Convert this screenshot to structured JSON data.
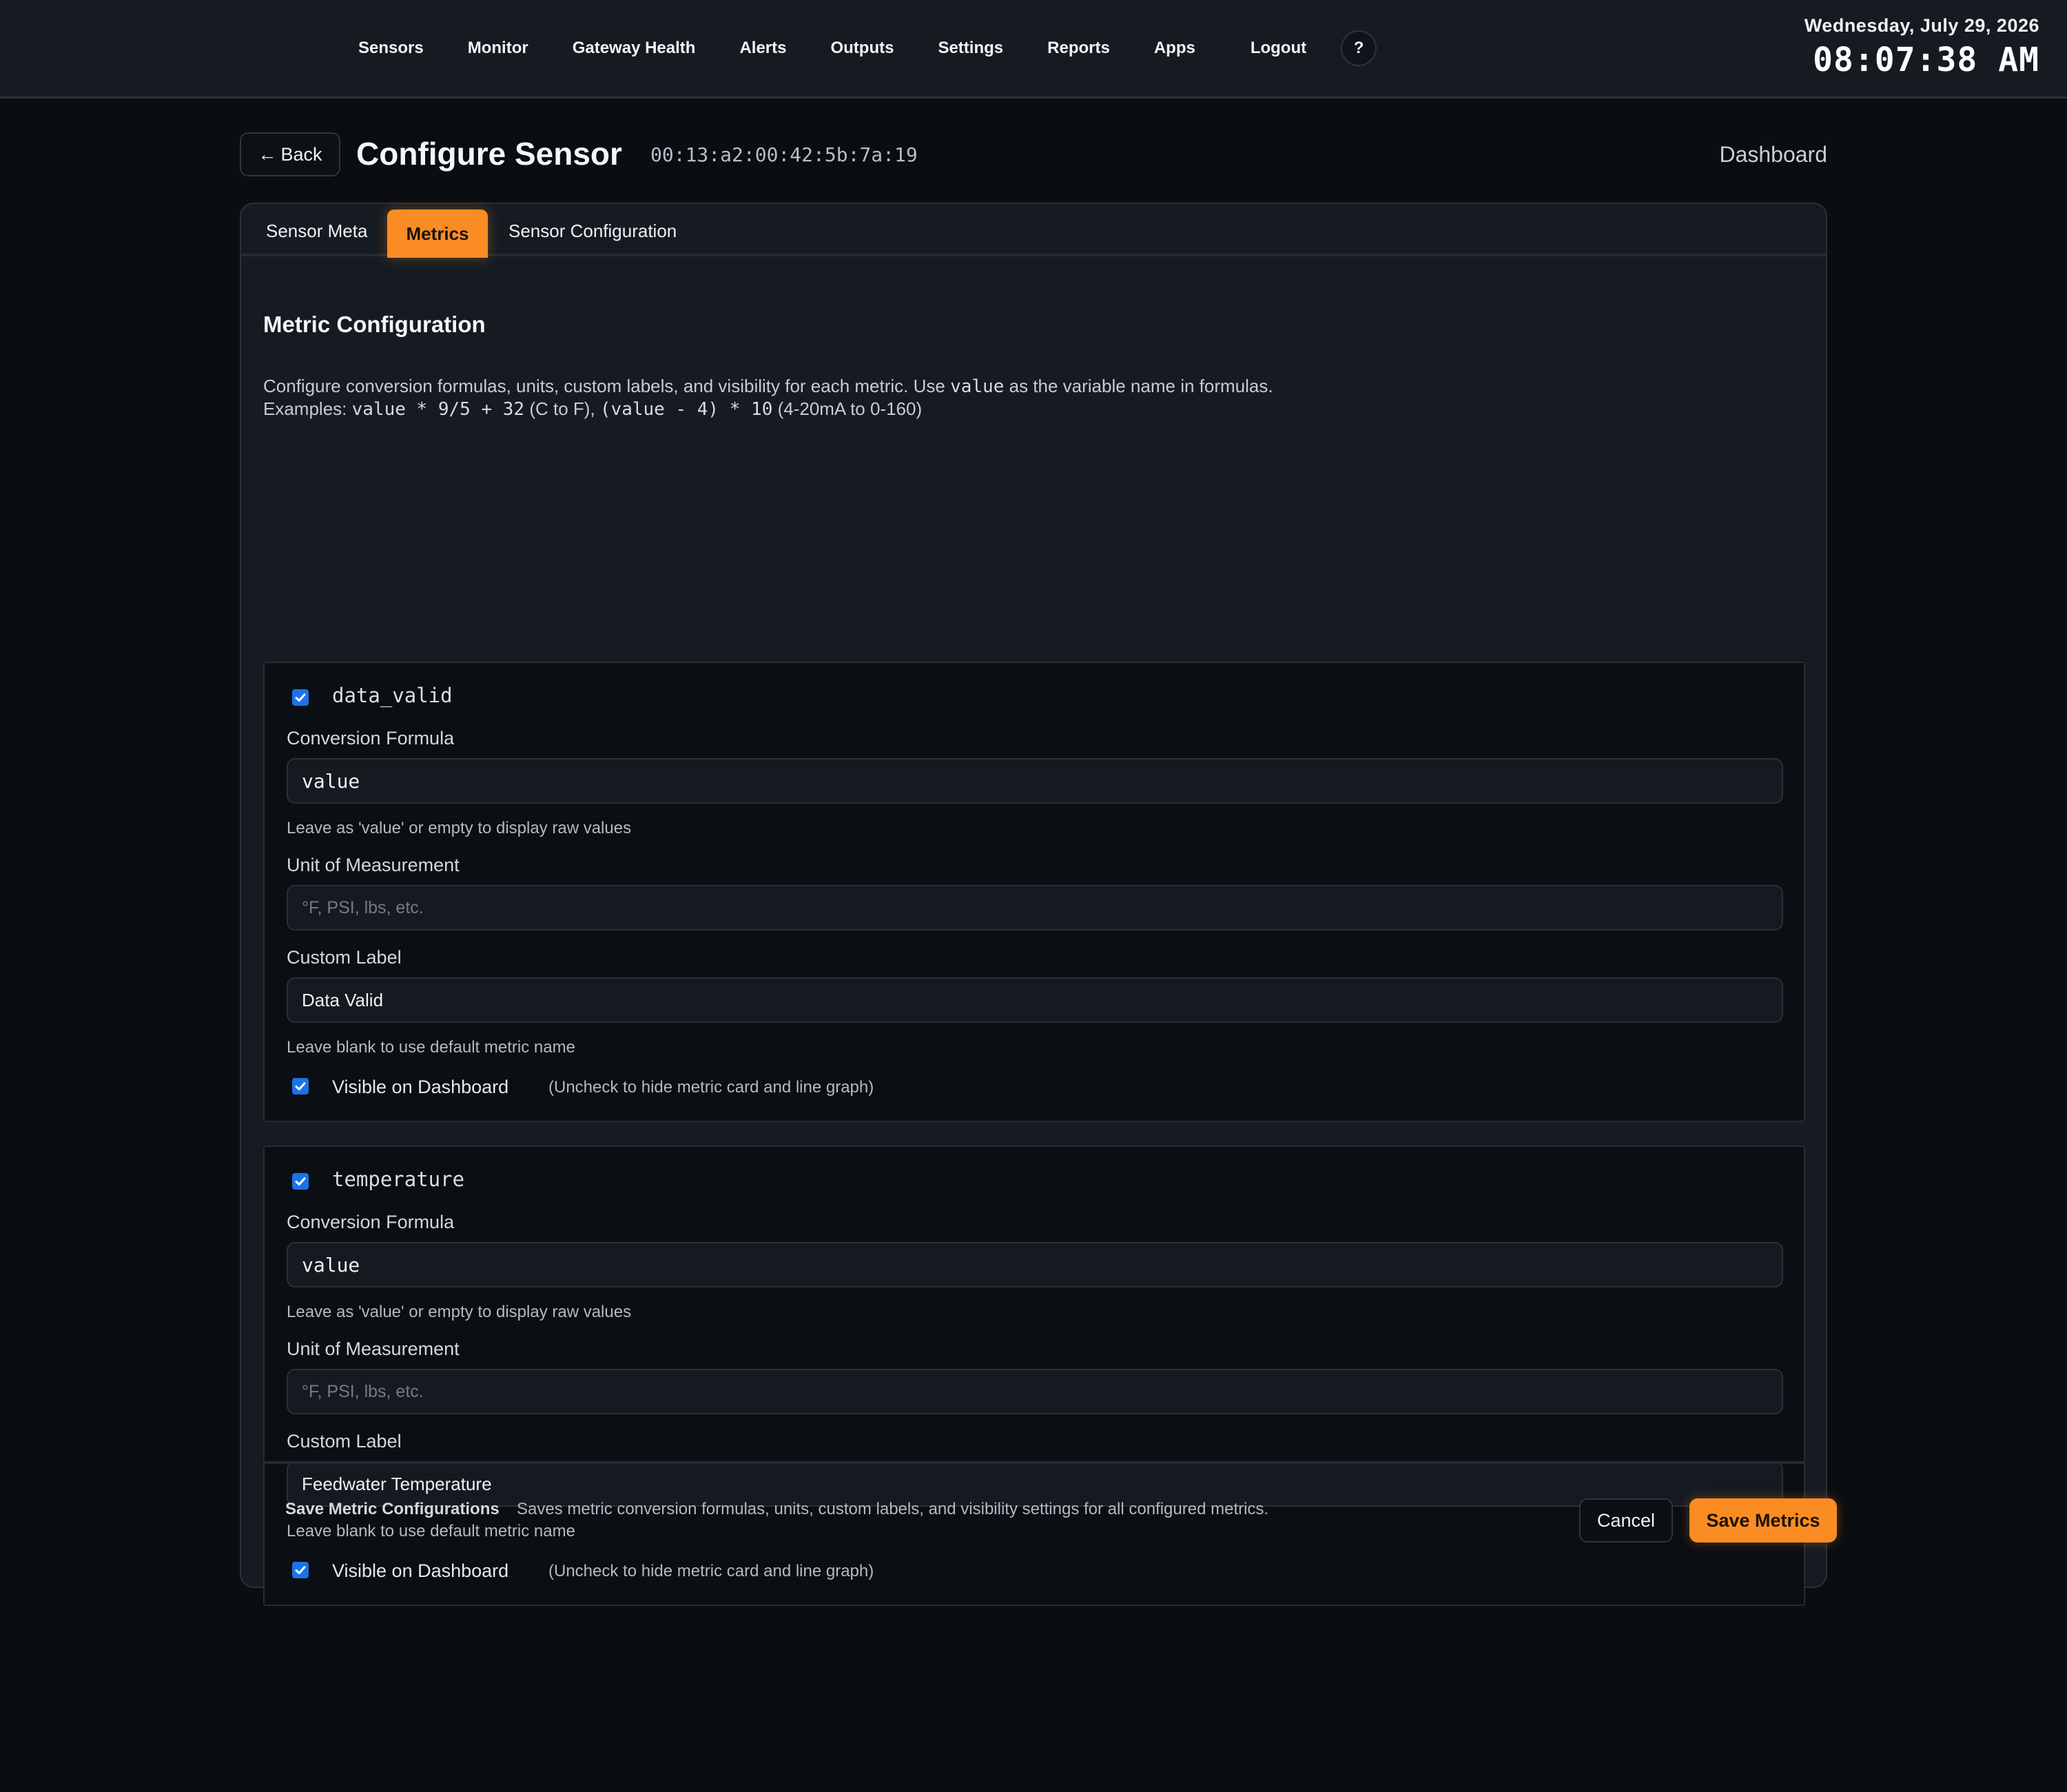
{
  "nav": {
    "items": [
      "Sensors",
      "Monitor",
      "Gateway Health",
      "Alerts",
      "Outputs",
      "Settings",
      "Reports",
      "Apps"
    ],
    "logout": "Logout",
    "help": "?"
  },
  "clock": {
    "date": "Wednesday, July 29, 2026",
    "time": "08:07:38 AM"
  },
  "header": {
    "back_label": "Back",
    "back_icon": "←",
    "title": "Configure Sensor",
    "sensor_id": "00:13:a2:00:42:5b:7a:19",
    "dashboard_link": "Dashboard"
  },
  "tabs": {
    "meta": "Sensor Meta",
    "metrics": "Metrics",
    "config": "Sensor Configuration",
    "active": "Metrics"
  },
  "section": {
    "title": "Metric Configuration",
    "intro_a": "Configure conversion formulas, units, custom labels, and visibility for each metric. Use",
    "intro_var": "value",
    "intro_b": "as the variable name in formulas.",
    "examples_label": "Examples:",
    "example1": "value * 9/5 + 32",
    "example1_note": "(C to F),",
    "example2": "(value - 4) * 10",
    "example2_note": "(4-20mA to 0-160)"
  },
  "labels": {
    "formula": "Conversion Formula",
    "formula_hint": "Leave as 'value' or empty to display raw values",
    "unit": "Unit of Measurement",
    "unit_placeholder": "°F, PSI, lbs, etc.",
    "custom": "Custom Label",
    "custom_hint": "Leave blank to use default metric name",
    "visible": "Visible on Dashboard",
    "visible_hint": "(Uncheck to hide metric card and line graph)"
  },
  "metrics": [
    {
      "name": "data_valid",
      "enabled": true,
      "formula": "value",
      "unit": "",
      "label": "Data Valid",
      "visible": true
    },
    {
      "name": "temperature",
      "enabled": true,
      "formula": "value",
      "unit": "",
      "label": "Feedwater Temperature",
      "visible": true
    }
  ],
  "footer": {
    "title": "Save Metric Configurations",
    "desc": "Saves metric conversion formulas, units, custom labels, and visibility settings for all configured metrics.",
    "cancel": "Cancel",
    "save": "Save Metrics"
  },
  "colors": {
    "accent": "#fb8c24",
    "checkbox": "#1a73e8",
    "background": "#0a0d11",
    "panel": "#161b22"
  }
}
